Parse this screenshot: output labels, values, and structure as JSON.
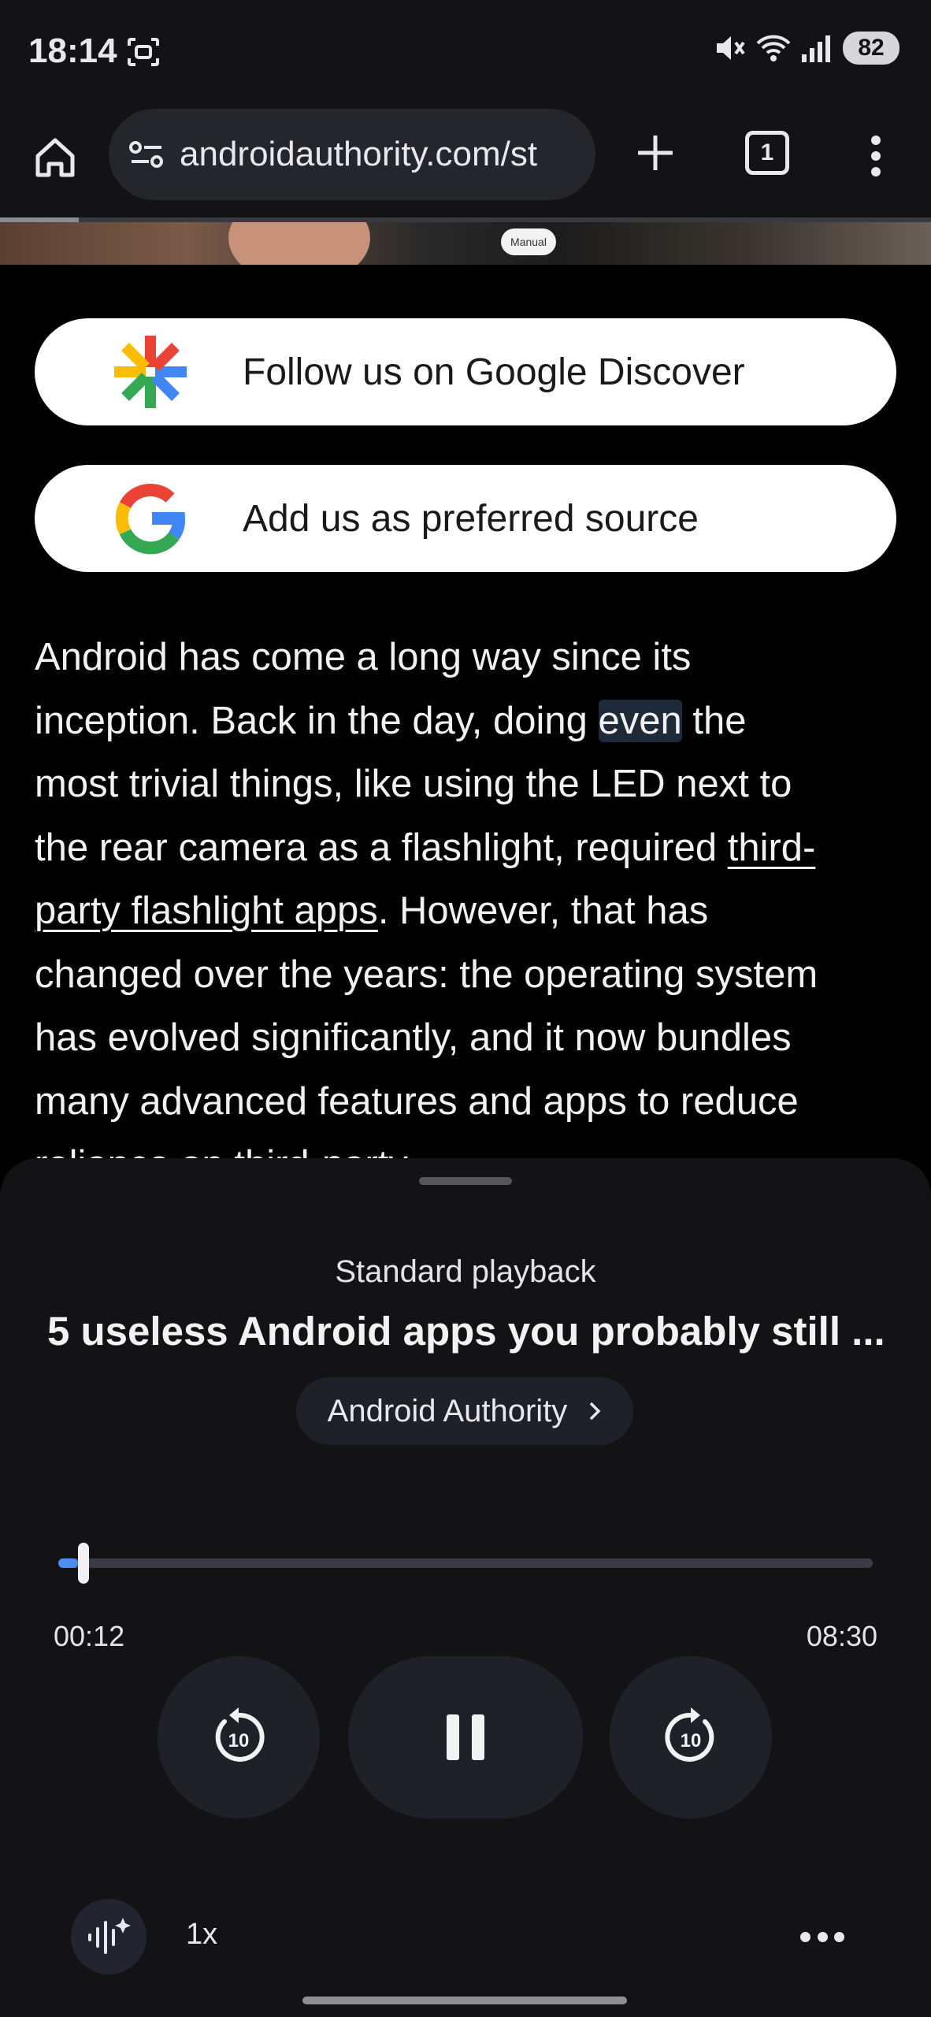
{
  "status_bar": {
    "time": "18:14",
    "battery": "82",
    "icons": [
      "screenshot-icon",
      "mute-icon",
      "wifi-icon",
      "signal-icon",
      "battery-icon"
    ]
  },
  "browser": {
    "url": "androidauthority.com/st",
    "tab_count": "1",
    "icons": [
      "home-icon",
      "site-settings-icon",
      "plus-icon",
      "tab-switcher-icon",
      "more-vertical-icon"
    ]
  },
  "hero_image": {
    "chip_text": "Manual"
  },
  "follow_buttons": [
    {
      "label": "Follow us on Google Discover",
      "icon": "google-discover-icon"
    },
    {
      "label": "Add us as preferred source",
      "icon": "google-g-icon"
    }
  ],
  "article": {
    "line1": "Android has come a long way since its",
    "line2_before": "inception. Back in the day, doing ",
    "line2_highlight": "even",
    "line2_after": " the",
    "line3": "most trivial things, like using the LED next to",
    "line4_before": "the rear camera as a flashlight, required ",
    "line4_link": "third-",
    "line5_link": "party flashlight apps",
    "line5_after": ". However, that has",
    "line6": "changed over the years: the operating system",
    "line7": "has evolved significantly, and it now bundles",
    "line8": "many advanced features and apps to reduce",
    "line9": "reliance on third-party"
  },
  "player": {
    "mode": "Standard playback",
    "title": "5 useless Android apps you probably still ...",
    "source": "Android Authority",
    "elapsed": "00:12",
    "total": "08:30",
    "progress_fraction": 0.024,
    "speed": "1x",
    "colors": {
      "accent": "#4c8df6",
      "sheet": "#131316",
      "control": "#1f2129"
    },
    "icons": [
      "replay-10-icon",
      "pause-icon",
      "forward-10-icon",
      "voice-sparkle-icon",
      "more-horizontal-icon",
      "chevron-right-icon"
    ]
  }
}
